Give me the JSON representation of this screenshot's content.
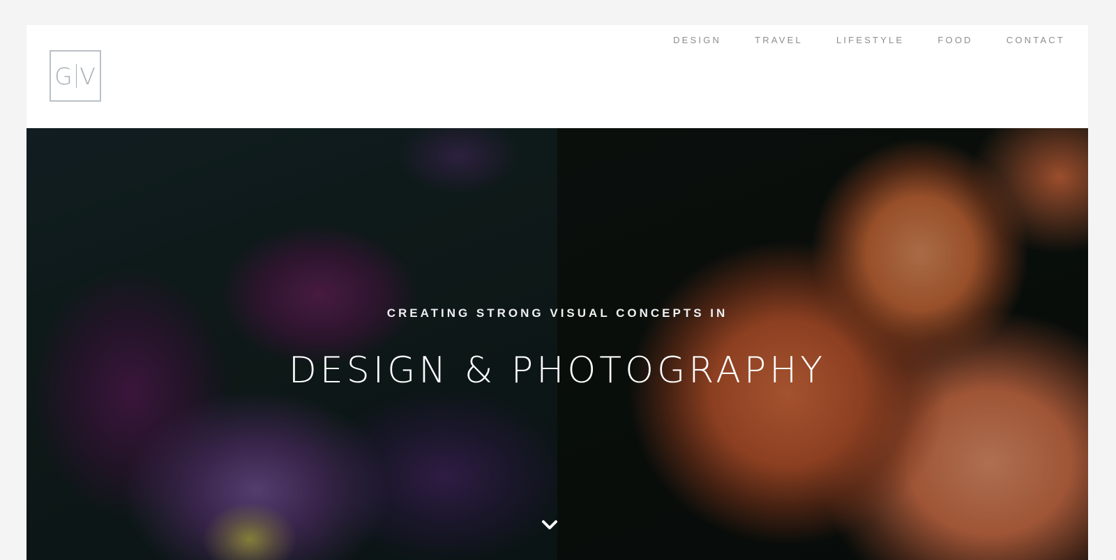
{
  "logo": {
    "left": "G",
    "right": "V"
  },
  "nav": {
    "items": [
      {
        "label": "DESIGN"
      },
      {
        "label": "TRAVEL"
      },
      {
        "label": "LIFESTYLE"
      },
      {
        "label": "FOOD"
      },
      {
        "label": "CONTACT"
      }
    ]
  },
  "hero": {
    "subtitle": "CREATING STRONG VISUAL CONCEPTS IN",
    "title": "DESIGN & PHOTOGRAPHY",
    "scroll_icon": "chevron-down-icon"
  },
  "colors": {
    "page_background": "#f4f4f4",
    "header_background": "#ffffff",
    "nav_text": "#8d8d8d",
    "logo_stroke": "#b9c0c6",
    "hero_text": "#ffffff"
  }
}
